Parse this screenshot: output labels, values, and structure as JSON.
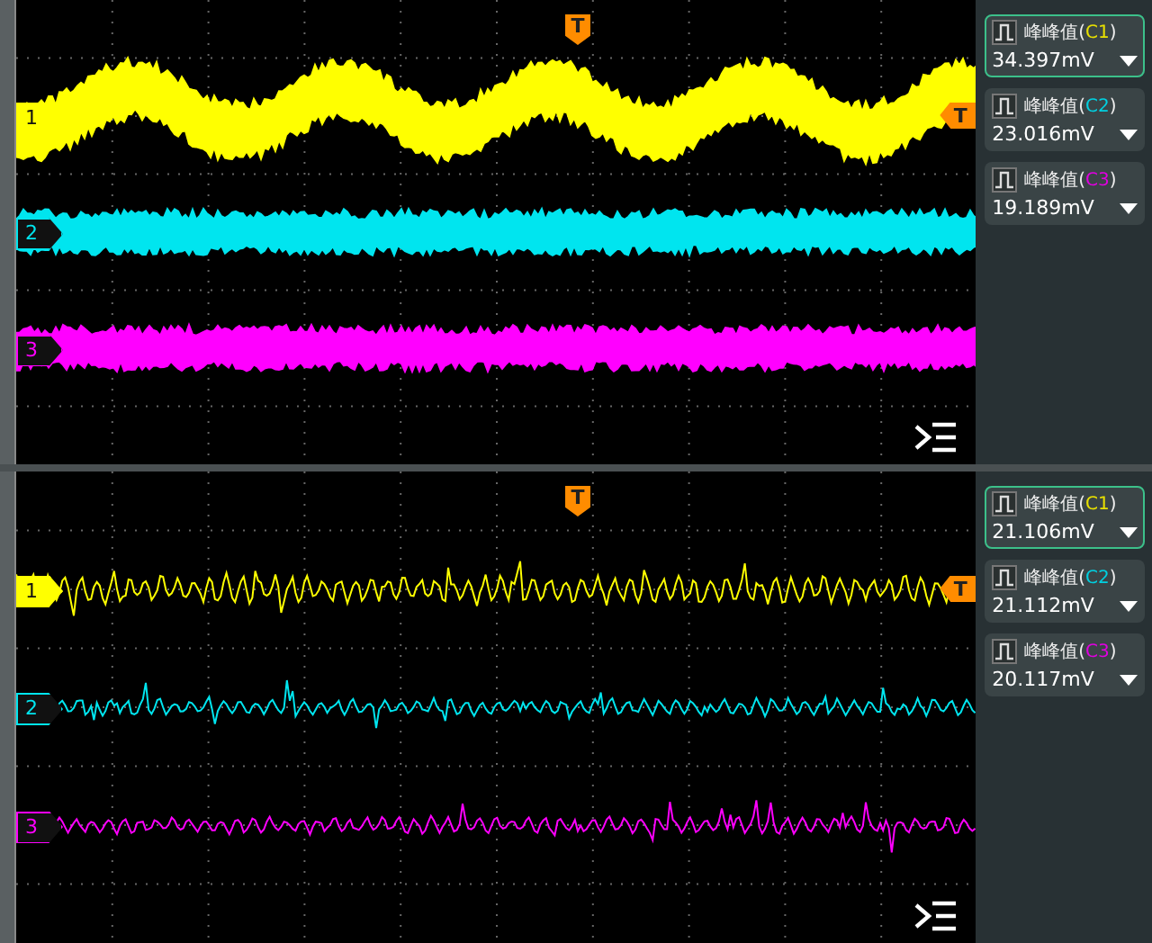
{
  "panes": [
    {
      "trigger_label": "T",
      "level_trigger_label": "T",
      "channels": [
        {
          "label": "1",
          "color": "#ffff00",
          "kind": "band"
        },
        {
          "label": "2",
          "color": "#00e5ef",
          "kind": "noise"
        },
        {
          "label": "3",
          "color": "#ff00ff",
          "kind": "noise"
        }
      ],
      "measurements": [
        {
          "name": "峰峰值(",
          "channel": "C1",
          "closing": ")",
          "value": "34.397mV",
          "selected": true,
          "color": "#e8e000"
        },
        {
          "name": "峰峰值(",
          "channel": "C2",
          "closing": ")",
          "value": "23.016mV",
          "selected": false,
          "color": "#00d0e0"
        },
        {
          "name": "峰峰值(",
          "channel": "C3",
          "closing": ")",
          "value": "19.189mV",
          "selected": false,
          "color": "#e000e0"
        }
      ]
    },
    {
      "trigger_label": "T",
      "level_trigger_label": "T",
      "channels": [
        {
          "label": "1",
          "color": "#ffff00",
          "kind": "spiky"
        },
        {
          "label": "2",
          "color": "#00e5ef",
          "kind": "spiky"
        },
        {
          "label": "3",
          "color": "#ff00ff",
          "kind": "spiky"
        }
      ],
      "measurements": [
        {
          "name": "峰峰值(",
          "channel": "C1",
          "closing": ")",
          "value": "21.106mV",
          "selected": true,
          "color": "#e8e000"
        },
        {
          "name": "峰峰值(",
          "channel": "C2",
          "closing": ")",
          "value": "21.112mV",
          "selected": false,
          "color": "#00d0e0"
        },
        {
          "name": "峰峰值(",
          "channel": "C3",
          "closing": ")",
          "value": "20.117mV",
          "selected": false,
          "color": "#e000e0"
        }
      ]
    }
  ]
}
